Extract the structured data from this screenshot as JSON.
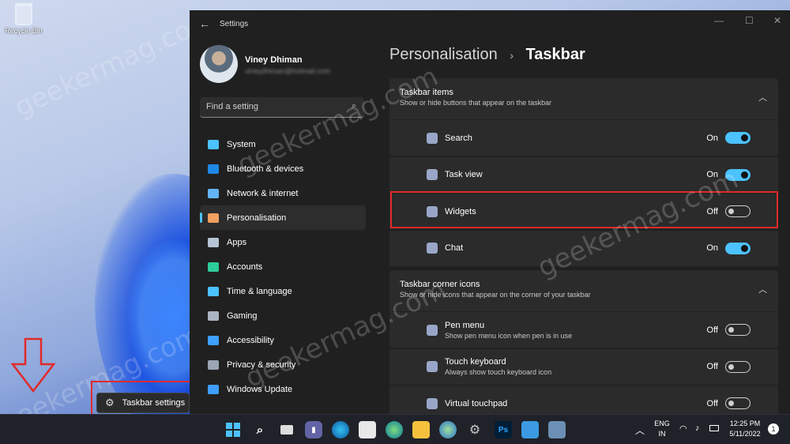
{
  "desktop": {
    "recycle_bin_label": "Recycle Bin",
    "watermark": "geekermag.com"
  },
  "context_popup": {
    "label": "Taskbar settings"
  },
  "window": {
    "title": "Settings",
    "profile": {
      "name": "Viney Dhiman",
      "email": "vineydhiman@hotmail.com"
    },
    "search_placeholder": "Find a setting",
    "nav": [
      {
        "label": "System",
        "icon": "monitor-icon",
        "color": "#4cc2ff"
      },
      {
        "label": "Bluetooth & devices",
        "icon": "bluetooth-icon",
        "color": "#1e88e5"
      },
      {
        "label": "Network & internet",
        "icon": "wifi-icon",
        "color": "#62b5f7"
      },
      {
        "label": "Personalisation",
        "icon": "brush-icon",
        "color": "#f0a060",
        "active": true
      },
      {
        "label": "Apps",
        "icon": "apps-icon",
        "color": "#b7c4d6"
      },
      {
        "label": "Accounts",
        "icon": "person-icon",
        "color": "#2ecc9a"
      },
      {
        "label": "Time & language",
        "icon": "globe-clock-icon",
        "color": "#4cc2ff"
      },
      {
        "label": "Gaming",
        "icon": "gamepad-icon",
        "color": "#aab4c2"
      },
      {
        "label": "Accessibility",
        "icon": "accessibility-icon",
        "color": "#3fa0ff"
      },
      {
        "label": "Privacy & security",
        "icon": "shield-icon",
        "color": "#9aa5b5"
      },
      {
        "label": "Windows Update",
        "icon": "update-icon",
        "color": "#3f9dff"
      }
    ],
    "breadcrumb": {
      "parent": "Personalisation",
      "separator": "›",
      "current": "Taskbar"
    },
    "taskbar_items": {
      "title": "Taskbar items",
      "subtitle": "Show or hide buttons that appear on the taskbar",
      "rows": [
        {
          "label": "Search",
          "state": "On",
          "on": true,
          "icon": "search-app-icon"
        },
        {
          "label": "Task view",
          "state": "On",
          "on": true,
          "icon": "task-view-icon"
        },
        {
          "label": "Widgets",
          "state": "Off",
          "on": false,
          "icon": "widgets-icon"
        },
        {
          "label": "Chat",
          "state": "On",
          "on": true,
          "icon": "chat-icon"
        }
      ]
    },
    "corner_icons": {
      "title": "Taskbar corner icons",
      "subtitle": "Show or hide icons that appear on the corner of your taskbar",
      "rows": [
        {
          "label": "Pen menu",
          "sub": "Show pen menu icon when pen is in use",
          "state": "Off",
          "on": false,
          "icon": "pen-icon"
        },
        {
          "label": "Touch keyboard",
          "sub": "Always show touch keyboard icon",
          "state": "Off",
          "on": false,
          "icon": "keyboard-icon"
        },
        {
          "label": "Virtual touchpad",
          "sub": "",
          "state": "Off",
          "on": false,
          "icon": "touchpad-icon"
        }
      ]
    }
  },
  "tray": {
    "lang": "ENG",
    "region": "IN",
    "time": "12:25 PM",
    "date": "5/11/2022",
    "notifications": "1",
    "ps_label": "Ps"
  }
}
